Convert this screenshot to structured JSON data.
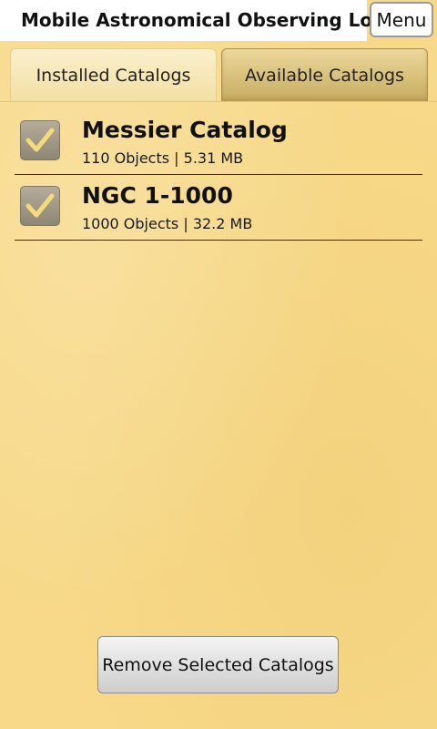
{
  "app": {
    "title": "Mobile Astronomical Observing Log",
    "menu_label": "Menu"
  },
  "tabs": [
    {
      "label": "Installed Catalogs",
      "selected": true
    },
    {
      "label": "Available Catalogs",
      "selected": false
    }
  ],
  "catalogs": [
    {
      "name": "Messier Catalog",
      "meta": "110 Objects | 5.31 MB",
      "checked": true
    },
    {
      "name": "NGC 1-1000",
      "meta": "1000 Objects | 32.2 MB",
      "checked": true
    }
  ],
  "actions": {
    "remove_label": "Remove Selected Catalogs"
  },
  "colors": {
    "background": "#f7d989",
    "check_mark": "#f5d97a"
  },
  "icons": {
    "checkbox": "checkmark-icon"
  }
}
